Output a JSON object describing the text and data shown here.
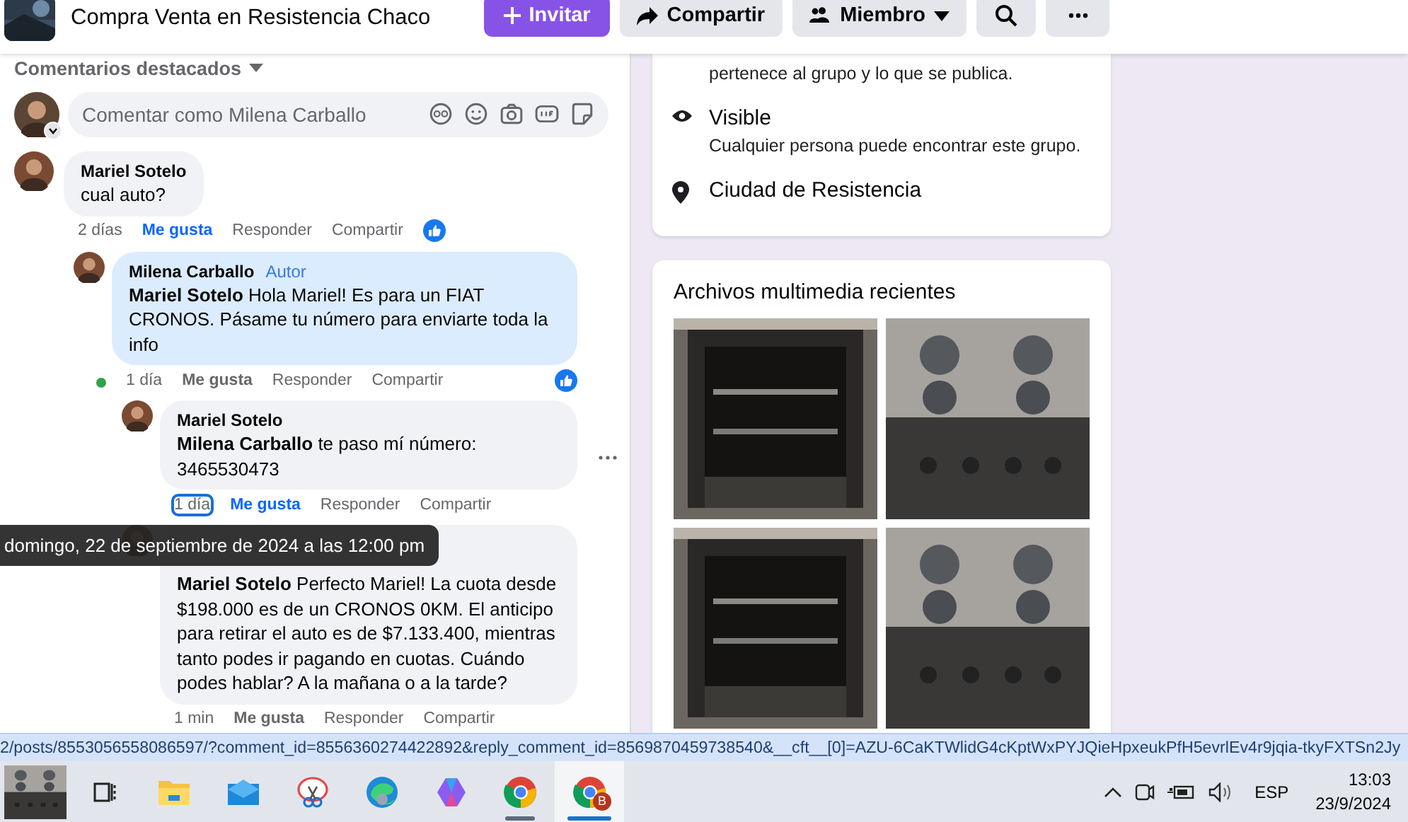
{
  "header": {
    "group_name": "Compra Venta en Resistencia Chaco",
    "buttons": [
      {
        "kind": "invite",
        "label": "Invitar"
      },
      {
        "kind": "share",
        "label": "Compartir"
      },
      {
        "kind": "member",
        "label": "Miembro"
      },
      {
        "kind": "search"
      },
      {
        "kind": "more"
      }
    ]
  },
  "comments_section": {
    "sort_label": "Comentarios destacados",
    "composer": {
      "placeholder": "Comentar como Milena Carballo"
    },
    "comments": [
      {
        "author": "Mariel Sotelo",
        "text": "cual auto?",
        "time": "2 días",
        "time_focused": false,
        "like_label": "Me gusta",
        "liked": true,
        "reply_label": "Responder",
        "share_label": "Compartir",
        "reaction": true,
        "highlighted": false,
        "online": false,
        "menu": false,
        "children": [
          {
            "author": "Milena Carballo",
            "badge": "Autor",
            "text": "**Mariel Sotelo** Hola Mariel! Es para un FIAT CRONOS. Pásame tu número para enviarte toda la info",
            "time": "1 día",
            "time_focused": false,
            "like_label": "Me gusta",
            "liked": false,
            "reply_label": "Responder",
            "share_label": "Compartir",
            "reaction": true,
            "highlighted": true,
            "online": true,
            "menu": false,
            "children": [
              {
                "author": "Mariel Sotelo",
                "text": "**Milena Carballo** te paso mí número: 3465530473",
                "time": "1 día",
                "time_focused": true,
                "like_label": "Me gusta",
                "liked": true,
                "reply_label": "Responder",
                "share_label": "Compartir",
                "reaction": false,
                "highlighted": false,
                "online": false,
                "menu": true
              },
              {
                "text": "**Mariel Sotelo** Perfecto Mariel! La cuota desde $198.000 es de un CRONOS 0KM. El anticipo para retirar el auto es de $7.133.400, mientras tanto podes ir pagando en cuotas. Cuándo podes hablar? A la mañana o a la tarde?",
                "time": "1 min",
                "time_focused": false,
                "like_label": "Me gusta",
                "liked": false,
                "reply_label": "Responder",
                "share_label": "Compartir",
                "reaction": false,
                "highlighted": false,
                "online": false,
                "menu": false
              }
            ]
          }
        ]
      }
    ],
    "tooltip": "domingo, 22 de septiembre de 2024 a las 12:00 pm"
  },
  "about": {
    "items": [
      {
        "kind": "privacy",
        "description": "pertenece al grupo y lo que se publica."
      },
      {
        "kind": "visible",
        "title": "Visible",
        "description": "Cualquier persona puede encontrar este grupo."
      },
      {
        "kind": "location",
        "title": "Ciudad de Resistencia"
      }
    ]
  },
  "media": {
    "title": "Archivos multimedia recientes"
  },
  "status_bar": {
    "url": "2/posts/8553056558086597/?comment_id=8556360274422892&reply_comment_id=8569870459738540&__cft__[0]=AZU-6CaKTWlidG4cKptWxPYJQieHpxeukPfH5evrlEv4r9jqia-tkyFXTSn2Jy"
  },
  "taskbar": {
    "apps": [
      {
        "kind": "widgets",
        "selected": false,
        "running": false
      },
      {
        "kind": "taskview",
        "selected": false,
        "running": false
      },
      {
        "kind": "explorer",
        "selected": false,
        "running": false
      },
      {
        "kind": "mail",
        "selected": false,
        "running": false
      },
      {
        "kind": "snip",
        "selected": false,
        "running": false
      },
      {
        "kind": "edge",
        "selected": false,
        "running": false
      },
      {
        "kind": "copilot",
        "selected": false,
        "running": false
      },
      {
        "kind": "chrome",
        "selected": false,
        "running": true
      },
      {
        "kind": "chrome",
        "selected": true,
        "running": true,
        "badge": "B"
      }
    ],
    "language": "ESP",
    "time": "13:03",
    "date": "23/9/2024"
  }
}
